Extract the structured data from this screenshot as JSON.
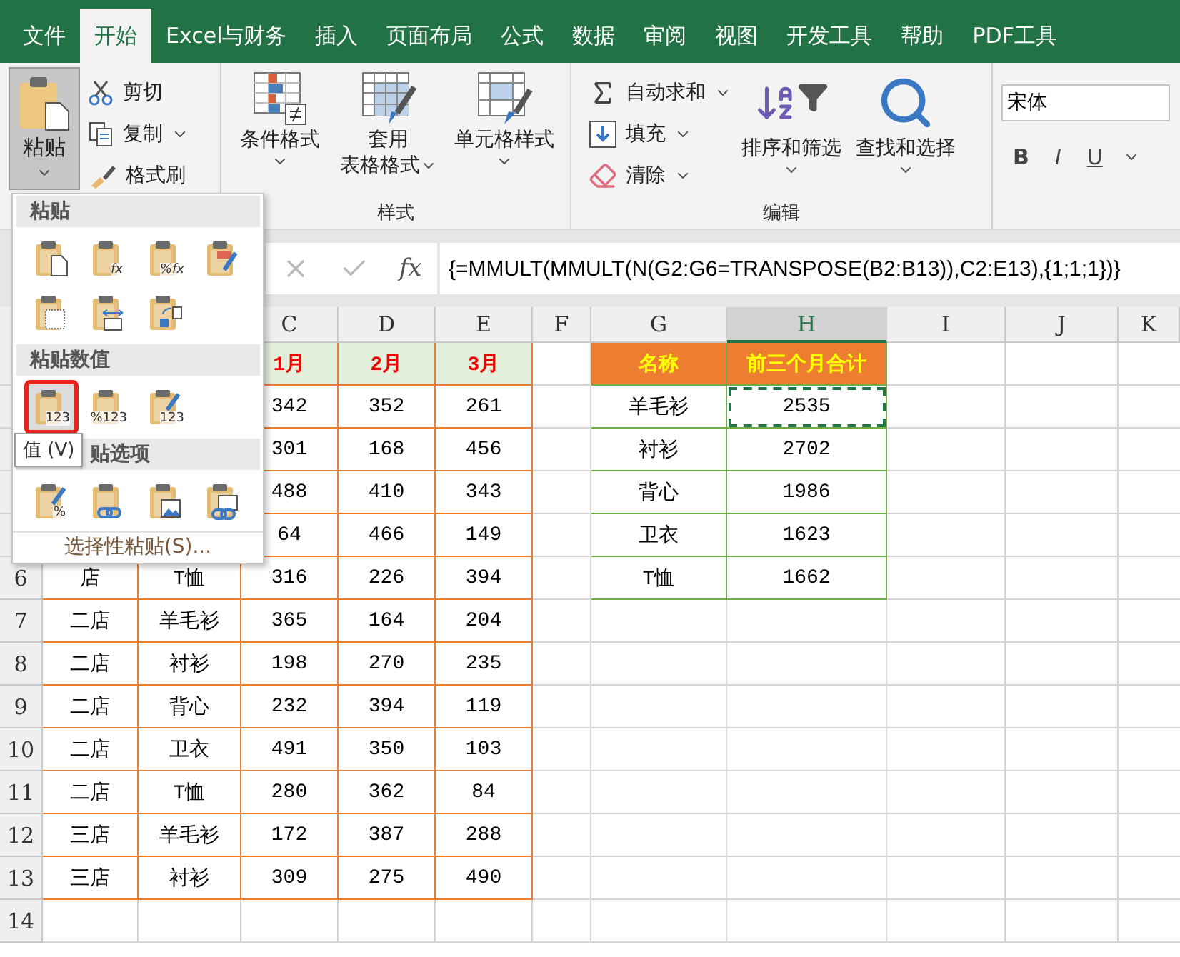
{
  "ribbon_tabs": [
    {
      "label": "文件",
      "selected": false
    },
    {
      "label": "开始",
      "selected": true
    },
    {
      "label": "Excel与财务",
      "selected": false
    },
    {
      "label": "插入",
      "selected": false
    },
    {
      "label": "页面布局",
      "selected": false
    },
    {
      "label": "公式",
      "selected": false
    },
    {
      "label": "数据",
      "selected": false
    },
    {
      "label": "审阅",
      "selected": false
    },
    {
      "label": "视图",
      "selected": false
    },
    {
      "label": "开发工具",
      "selected": false
    },
    {
      "label": "帮助",
      "selected": false
    },
    {
      "label": "PDF工具",
      "selected": false
    }
  ],
  "clipboard": {
    "paste": {
      "label": "粘贴",
      "pressed": true
    },
    "items": [
      {
        "kind": "cut",
        "label": "剪切",
        "dropdown": false
      },
      {
        "kind": "copy",
        "label": "复制",
        "dropdown": true
      },
      {
        "kind": "format_painter",
        "label": "格式刷",
        "dropdown": false
      }
    ]
  },
  "styles_group": {
    "label": "样式",
    "buttons": [
      {
        "kind": "conditional",
        "lines": [
          "条件格式"
        ]
      },
      {
        "kind": "table",
        "lines": [
          "套用",
          "表格格式"
        ]
      },
      {
        "kind": "cell_styles",
        "lines": [
          "单元格样式"
        ]
      }
    ]
  },
  "editing_group": {
    "label": "编辑",
    "small": [
      {
        "kind": "sum",
        "label": "自动求和"
      },
      {
        "kind": "fill",
        "label": "填充"
      },
      {
        "kind": "clear",
        "label": "清除"
      }
    ],
    "large": [
      {
        "kind": "sort",
        "label": "排序和筛选"
      },
      {
        "kind": "find",
        "label": "查找和选择"
      }
    ]
  },
  "font_group": {
    "font": "宋体",
    "buttons": [
      {
        "kind": "bold",
        "label": "B"
      },
      {
        "kind": "italic",
        "label": "I"
      },
      {
        "kind": "underline",
        "label": "U"
      }
    ]
  },
  "formula_bar": {
    "function_label": "fx",
    "formula": "{=MMULT(MMULT(N(G2:G6=TRANSPOSE(B2:B13)),C2:E13),{1;1;1})}"
  },
  "column_headers": [
    {
      "label": "C",
      "selected": false
    },
    {
      "label": "D",
      "selected": false
    },
    {
      "label": "E",
      "selected": false
    },
    {
      "label": "F",
      "selected": false
    },
    {
      "label": "G",
      "selected": false
    },
    {
      "label": "H",
      "selected": true
    },
    {
      "label": "I",
      "selected": false
    },
    {
      "label": "J",
      "selected": false
    },
    {
      "label": "K",
      "selected": false
    }
  ],
  "row_headers": [
    "6",
    "7",
    "8",
    "9",
    "10",
    "11",
    "12",
    "13",
    "14"
  ],
  "sales_table": {
    "rows": [
      {
        "kind": "header",
        "cells": [
          "1月",
          "2月",
          "3月"
        ]
      },
      {
        "kind": "data",
        "cells": [
          "342",
          "352",
          "261"
        ]
      },
      {
        "kind": "data",
        "cells": [
          "301",
          "168",
          "456"
        ]
      },
      {
        "kind": "data",
        "cells": [
          "488",
          "410",
          "343"
        ]
      },
      {
        "kind": "data",
        "cells": [
          "64",
          "466",
          "149"
        ]
      },
      {
        "kind": "data",
        "cells": [
          "店",
          "T恤",
          "316",
          "226",
          "394"
        ]
      },
      {
        "kind": "data",
        "cells": [
          "二店",
          "羊毛衫",
          "365",
          "164",
          "204"
        ]
      },
      {
        "kind": "data",
        "cells": [
          "二店",
          "衬衫",
          "198",
          "270",
          "235"
        ]
      },
      {
        "kind": "data",
        "cells": [
          "二店",
          "背心",
          "232",
          "394",
          "119"
        ]
      },
      {
        "kind": "data",
        "cells": [
          "二店",
          "卫衣",
          "491",
          "350",
          "103"
        ]
      },
      {
        "kind": "data",
        "cells": [
          "二店",
          "T恤",
          "280",
          "362",
          "84"
        ]
      },
      {
        "kind": "data",
        "cells": [
          "三店",
          "羊毛衫",
          "172",
          "387",
          "288"
        ]
      },
      {
        "kind": "data",
        "cells": [
          "三店",
          "衬衫",
          "309",
          "275",
          "490"
        ]
      }
    ]
  },
  "summary_table": {
    "columns": [
      "名称",
      "前三个月合计"
    ],
    "rows": [
      {
        "name": "羊毛衫",
        "total": "2535",
        "copied": true
      },
      {
        "name": "衬衫",
        "total": "2702",
        "copied": false
      },
      {
        "name": "背心",
        "total": "1986",
        "copied": false
      },
      {
        "name": "卫衣",
        "total": "1623",
        "copied": false
      },
      {
        "name": "T恤",
        "total": "1662",
        "copied": false
      }
    ]
  },
  "paste_menu": {
    "sections": [
      {
        "title": "粘贴",
        "options": [
          {
            "kind": "paste",
            "selected": false,
            "highlighted": false
          },
          {
            "kind": "formulas",
            "glyph": "fx",
            "selected": false,
            "highlighted": false
          },
          {
            "kind": "formulas_number_format",
            "glyph": "%fx",
            "selected": false,
            "highlighted": false
          },
          {
            "kind": "keep_source_format",
            "selected": false,
            "highlighted": false
          },
          {
            "kind": "no_borders",
            "selected": false,
            "highlighted": false
          },
          {
            "kind": "keep_column_widths",
            "selected": false,
            "highlighted": false
          },
          {
            "kind": "transpose",
            "selected": false,
            "highlighted": false
          }
        ]
      },
      {
        "title": "粘贴数值",
        "options": [
          {
            "kind": "values",
            "glyph": "123",
            "selected": true,
            "highlighted": true
          },
          {
            "kind": "values_number_format",
            "glyph": "%123",
            "selected": false,
            "highlighted": false
          },
          {
            "kind": "values_source_format",
            "glyph": "123",
            "selected": false,
            "highlighted": false
          }
        ]
      },
      {
        "title": "贴选项",
        "options": [
          {
            "kind": "formatting",
            "glyph": "%",
            "selected": false,
            "highlighted": false
          },
          {
            "kind": "paste_link",
            "selected": false,
            "highlighted": false
          },
          {
            "kind": "picture",
            "selected": false,
            "highlighted": false
          },
          {
            "kind": "linked_picture",
            "selected": false,
            "highlighted": false
          }
        ]
      }
    ],
    "footer": "选择性粘贴(S)...",
    "tooltip": "值 (V)"
  }
}
